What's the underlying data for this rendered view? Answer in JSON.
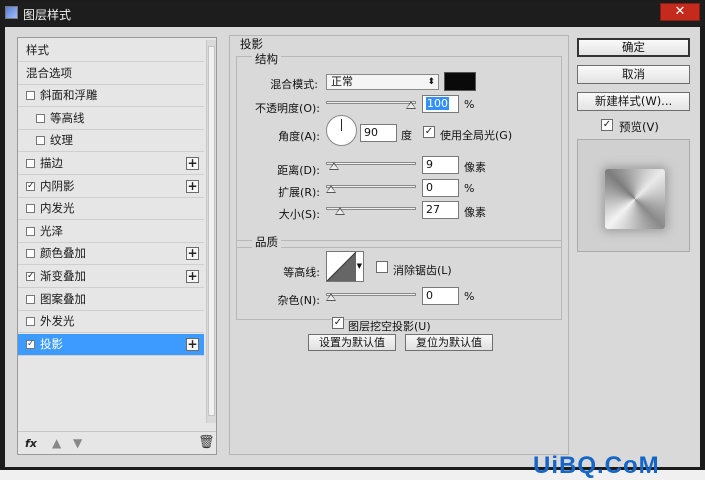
{
  "window": {
    "title": "图层样式",
    "close_icon": "✕"
  },
  "left_list": {
    "items": [
      {
        "label": "样式",
        "checkbox": false,
        "checked": false,
        "plus": false,
        "indent": 0,
        "selected": false
      },
      {
        "label": "混合选项",
        "checkbox": false,
        "checked": false,
        "plus": false,
        "indent": 0,
        "selected": false
      },
      {
        "label": "斜面和浮雕",
        "checkbox": true,
        "checked": false,
        "plus": false,
        "indent": 0,
        "selected": false
      },
      {
        "label": "等高线",
        "checkbox": true,
        "checked": false,
        "plus": false,
        "indent": 1,
        "selected": false
      },
      {
        "label": "纹理",
        "checkbox": true,
        "checked": false,
        "plus": false,
        "indent": 1,
        "selected": false
      },
      {
        "label": "描边",
        "checkbox": true,
        "checked": false,
        "plus": true,
        "indent": 0,
        "selected": false
      },
      {
        "label": "内阴影",
        "checkbox": true,
        "checked": true,
        "plus": true,
        "indent": 0,
        "selected": false
      },
      {
        "label": "内发光",
        "checkbox": true,
        "checked": false,
        "plus": false,
        "indent": 0,
        "selected": false
      },
      {
        "label": "光泽",
        "checkbox": true,
        "checked": false,
        "plus": false,
        "indent": 0,
        "selected": false
      },
      {
        "label": "颜色叠加",
        "checkbox": true,
        "checked": false,
        "plus": true,
        "indent": 0,
        "selected": false
      },
      {
        "label": "渐变叠加",
        "checkbox": true,
        "checked": true,
        "plus": true,
        "indent": 0,
        "selected": false
      },
      {
        "label": "图案叠加",
        "checkbox": true,
        "checked": false,
        "plus": false,
        "indent": 0,
        "selected": false
      },
      {
        "label": "外发光",
        "checkbox": true,
        "checked": false,
        "plus": false,
        "indent": 0,
        "selected": false
      },
      {
        "label": "投影",
        "checkbox": true,
        "checked": true,
        "plus": true,
        "indent": 0,
        "selected": true
      }
    ],
    "fx_label": "fx",
    "plus_glyph": "+",
    "check_glyph": "✓"
  },
  "panel": {
    "title": "投影",
    "structure": {
      "title": "结构",
      "blend_mode_label": "混合模式:",
      "blend_mode_value": "正常",
      "opacity_label": "不透明度(O):",
      "opacity_value": "100",
      "opacity_unit": "%",
      "opacity_fraction": 1.0,
      "angle_label": "角度(A):",
      "angle_value": "90",
      "angle_unit": "度",
      "global_light_label": "使用全局光(G)",
      "global_light_checked": true,
      "distance_label": "距离(D):",
      "distance_value": "9",
      "distance_unit": "像素",
      "distance_fraction": 0.04,
      "spread_label": "扩展(R):",
      "spread_value": "0",
      "spread_unit": "%",
      "spread_fraction": 0.0,
      "size_label": "大小(S):",
      "size_value": "27",
      "size_unit": "像素",
      "size_fraction": 0.11
    },
    "quality": {
      "title": "品质",
      "contour_label": "等高线:",
      "antialias_label": "消除锯齿(L)",
      "antialias_checked": false,
      "noise_label": "杂色(N):",
      "noise_value": "0",
      "noise_unit": "%",
      "noise_fraction": 0.0
    },
    "knockout_label": "图层挖空投影(U)",
    "knockout_checked": true,
    "set_default_button": "设置为默认值",
    "reset_default_button": "复位为默认值"
  },
  "right": {
    "ok_button": "确定",
    "cancel_button": "取消",
    "new_style_button": "新建样式(W)...",
    "preview_label": "预览(V)",
    "preview_checked": true
  },
  "watermark": "UiBQ.CoM",
  "colors": {
    "selection": "#3d9bff",
    "shadow_color": "#0a0a0a",
    "watermark": "#1566c7"
  }
}
